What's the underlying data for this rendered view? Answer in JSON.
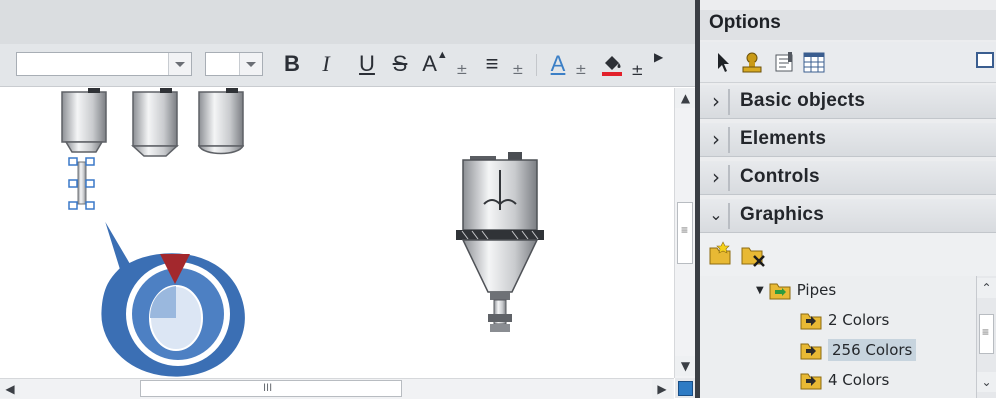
{
  "toolbar": {
    "font_family_value": "",
    "font_size_value": "",
    "bold": "B",
    "italic": "I",
    "underline": "U",
    "strikethrough": "S",
    "font_size_up": "A",
    "align": "≡",
    "text_color": "A",
    "dropdown_glyph": "±"
  },
  "options": {
    "title": "Options",
    "sections": [
      {
        "label": "Basic objects",
        "expanded": false
      },
      {
        "label": "Elements",
        "expanded": false
      },
      {
        "label": "Controls",
        "expanded": false
      },
      {
        "label": "Graphics",
        "expanded": true
      }
    ],
    "tree": {
      "parent": "Pipes",
      "items": [
        {
          "label": "2 Colors",
          "selected": false
        },
        {
          "label": "256 Colors",
          "selected": true
        },
        {
          "label": "4 Colors",
          "selected": false
        }
      ]
    }
  },
  "scrollbar": {
    "grip": "III",
    "grip_vertical": "≡"
  },
  "colors": {
    "selection_handle": "#3a78c8",
    "callout_blue": "#3b6fb4",
    "arrow_red": "#a3282d",
    "divider": "#3a3e44"
  }
}
